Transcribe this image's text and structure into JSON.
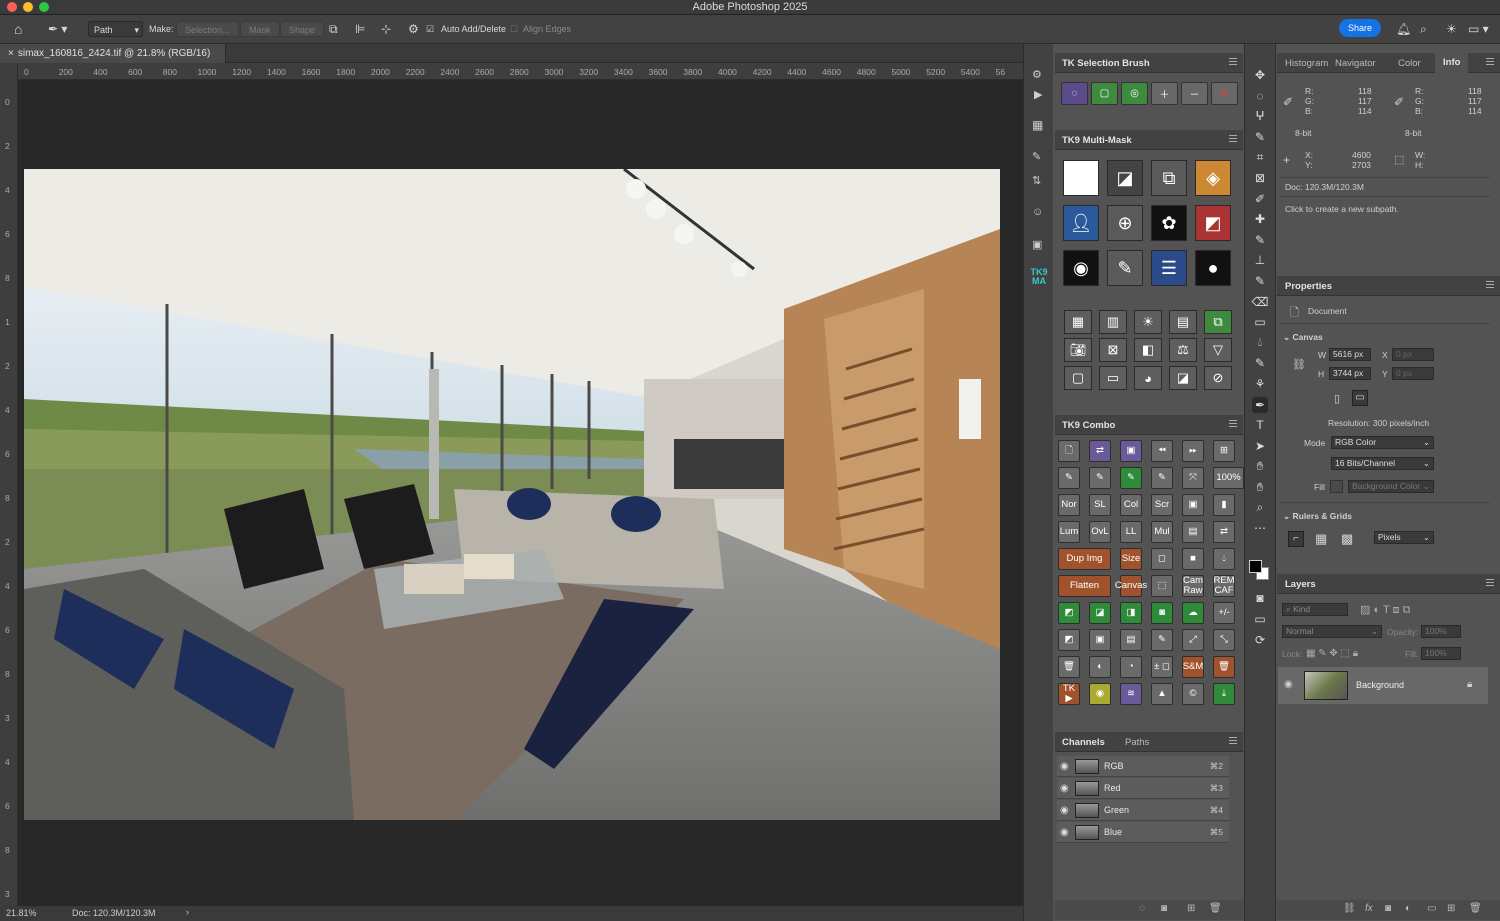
{
  "app": {
    "title": "Adobe Photoshop 2025"
  },
  "options": {
    "mode": "Path",
    "make_label": "Make:",
    "selection_btn": "Selection...",
    "mask_btn": "Mask",
    "shape_btn": "Shape",
    "auto_add_delete": "Auto Add/Delete",
    "align_edges": "Align Edges",
    "share": "Share"
  },
  "document": {
    "tab": "simax_160816_2424.tif @ 21.8% (RGB/16)",
    "zoom": "21.81%",
    "doc_size": "Doc: 120.3M/120.3M"
  },
  "ruler_h": [
    "0",
    "200",
    "400",
    "600",
    "800",
    "1000",
    "1200",
    "1400",
    "1600",
    "1800",
    "2000",
    "2200",
    "2400",
    "2600",
    "2800",
    "3000",
    "3200",
    "3400",
    "3600",
    "3800",
    "4000",
    "4200",
    "4400",
    "4600",
    "4800",
    "5000",
    "5200",
    "5400",
    "56"
  ],
  "ruler_v": [
    "0",
    "2",
    "4",
    "6",
    "8",
    "1",
    "2",
    "4",
    "6",
    "8",
    "2",
    "4",
    "6",
    "8",
    "3",
    "4",
    "6",
    "8",
    "3"
  ],
  "tk_selection_brush": {
    "title": "TK Selection Brush"
  },
  "tk9_multimask": {
    "title": "TK9 Multi-Mask"
  },
  "tk9_combo": {
    "title": "TK9 Combo",
    "labels": {
      "hundred": "100%",
      "nor": "Nor",
      "sl": "SL",
      "col": "Col",
      "scr": "Scr",
      "lum": "Lum",
      "ovl": "OvL",
      "ll": "LL",
      "mul": "Mul",
      "dupimg": "Dup Img",
      "size": "Size",
      "flatten": "Flatten",
      "canvas": "Canvas",
      "camraw": "Cam Raw",
      "remcaf": "REM CAF",
      "plusminus": "+/-",
      "pmsq": "± ◻",
      "sm": "S&M",
      "tk": "TK ▶"
    }
  },
  "tk9_ma_logo": "TK9 MA",
  "channels": {
    "tabs": [
      "Channels",
      "Paths"
    ],
    "rows": [
      {
        "name": "RGB",
        "shortcut": "⌘2"
      },
      {
        "name": "Red",
        "shortcut": "⌘3"
      },
      {
        "name": "Green",
        "shortcut": "⌘4"
      },
      {
        "name": "Blue",
        "shortcut": "⌘5"
      }
    ]
  },
  "info_panel": {
    "tabs": [
      "Histogram",
      "Navigator",
      "Color",
      "Info"
    ],
    "r_label": "R:",
    "g_label": "G:",
    "b_label": "B:",
    "r": "118",
    "g": "117",
    "b": "114",
    "r2": "118",
    "g2": "117",
    "b2": "114",
    "bit1": "8-bit",
    "bit2": "8-bit",
    "x_label": "X:",
    "y_label": "Y:",
    "x": "4600",
    "y": "2703",
    "w_label": "W:",
    "h_label": "H:",
    "doc": "Doc: 120.3M/120.3M",
    "hint": "Click to create a new subpath."
  },
  "properties": {
    "title": "Properties",
    "document": "Document",
    "canvas_section": "Canvas",
    "w_label": "W",
    "h_label": "H",
    "x_label": "X",
    "y_label": "Y",
    "w": "5616 px",
    "h": "3744 px",
    "x_ph": "0 px",
    "y_ph": "0 px",
    "resolution": "Resolution: 300 pixels/inch",
    "mode_label": "Mode",
    "mode": "RGB Color",
    "bits": "16 Bits/Channel",
    "fill_label": "Fill",
    "fill": "Background Color",
    "rulers_section": "Rulers & Grids",
    "units": "Pixels"
  },
  "layers": {
    "title": "Layers",
    "kind": "Kind",
    "blend": "Normal",
    "opacity_label": "Opacity:",
    "opacity": "100%",
    "lock_label": "Lock:",
    "fill_label": "Fill:",
    "fill": "100%",
    "layer_name": "Background"
  }
}
